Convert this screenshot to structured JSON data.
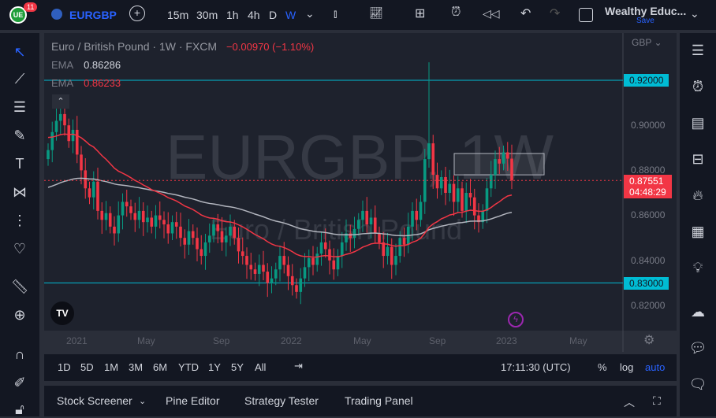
{
  "header": {
    "symbol": "EURGBP",
    "notification_count": "11",
    "intervals": [
      "15m",
      "30m",
      "1h",
      "4h",
      "D",
      "W"
    ],
    "active_interval": "W",
    "layout_name": "Wealthy Educ...",
    "save_label": "Save"
  },
  "legend": {
    "title": "Euro / British Pound · 1W · FXCM",
    "change": "−0.00970 (−1.10%)",
    "ema1_label": "EMA",
    "ema1_value": "0.86286",
    "ema2_label": "EMA",
    "ema2_value": "0.86233"
  },
  "watermark": {
    "symbol": "EURGBP, 1W",
    "name": "Euro / British Pound"
  },
  "price_axis": {
    "currency": "GBP",
    "ticks": [
      "0.90000",
      "0.88000",
      "0.86000",
      "0.84000",
      "0.82000"
    ],
    "line_labels": [
      "0.92000",
      "0.83000"
    ],
    "current_price": "0.87551",
    "countdown": "04:48:29"
  },
  "time_axis": [
    "2021",
    "May",
    "Sep",
    "2022",
    "May",
    "Sep",
    "2023",
    "May"
  ],
  "range_bar": {
    "ranges": [
      "1D",
      "5D",
      "1M",
      "3M",
      "6M",
      "YTD",
      "1Y",
      "5Y",
      "All"
    ],
    "clock": "17:11:30 (UTC)",
    "percent": "%",
    "log": "log",
    "auto": "auto"
  },
  "bottom_panel": {
    "tabs": [
      "Stock Screener",
      "Pine Editor",
      "Strategy Tester",
      "Trading Panel"
    ]
  },
  "colors": {
    "up": "#089981",
    "down": "#f23645",
    "cyan": "#00bcd4",
    "accent": "#2962ff"
  },
  "chart_data": {
    "type": "candlestick",
    "symbol": "EURGBP",
    "timeframe": "1W",
    "ylim": [
      0.81,
      0.935
    ],
    "closes": [
      0.889,
      0.897,
      0.902,
      0.905,
      0.9,
      0.893,
      0.898,
      0.887,
      0.88,
      0.872,
      0.868,
      0.875,
      0.862,
      0.858,
      0.861,
      0.855,
      0.852,
      0.86,
      0.866,
      0.864,
      0.861,
      0.858,
      0.862,
      0.857,
      0.859,
      0.855,
      0.86,
      0.858,
      0.856,
      0.852,
      0.857,
      0.855,
      0.85,
      0.847,
      0.853,
      0.85,
      0.845,
      0.842,
      0.848,
      0.851,
      0.856,
      0.853,
      0.848,
      0.851,
      0.855,
      0.85,
      0.844,
      0.842,
      0.838,
      0.836,
      0.834,
      0.838,
      0.835,
      0.83,
      0.832,
      0.836,
      0.842,
      0.838,
      0.833,
      0.829,
      0.826,
      0.832,
      0.837,
      0.841,
      0.838,
      0.843,
      0.848,
      0.845,
      0.84,
      0.836,
      0.842,
      0.848,
      0.852,
      0.85,
      0.854,
      0.858,
      0.862,
      0.856,
      0.859,
      0.852,
      0.848,
      0.842,
      0.846,
      0.838,
      0.842,
      0.85,
      0.847,
      0.855,
      0.862,
      0.858,
      0.866,
      0.885,
      0.892,
      0.878,
      0.872,
      0.877,
      0.87,
      0.874,
      0.866,
      0.872,
      0.862,
      0.87,
      0.868,
      0.86,
      0.857,
      0.862,
      0.872,
      0.878,
      0.885,
      0.883,
      0.888,
      0.8852,
      0.8755
    ],
    "spike_high": 0.928,
    "horizontal_lines": [
      0.92,
      0.83
    ],
    "box": [
      0.8875,
      0.878
    ]
  }
}
